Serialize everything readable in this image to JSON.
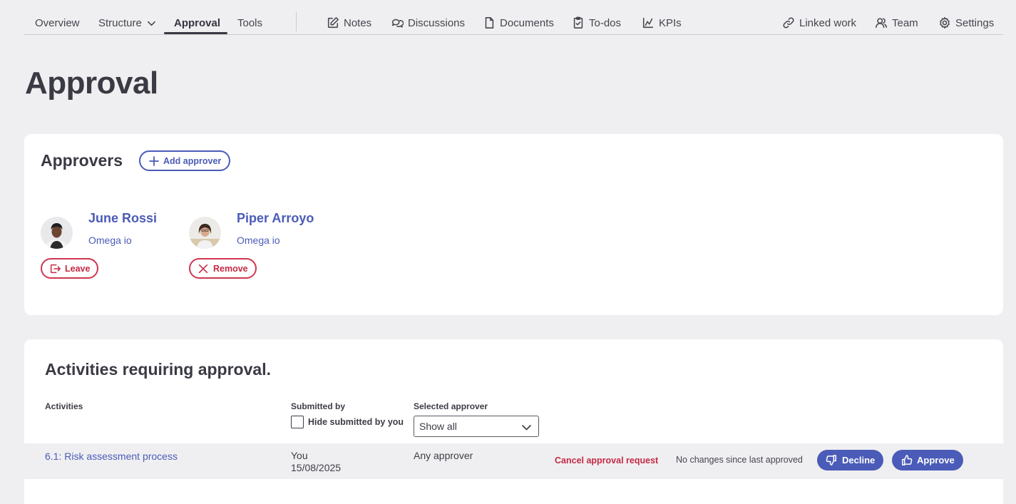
{
  "nav": {
    "left_tabs": [
      "Overview",
      "Structure",
      "Approval",
      "Tools"
    ],
    "tools": [
      "Notes",
      "Discussions",
      "Documents",
      "To-dos",
      "KPIs"
    ],
    "right": [
      "Linked work",
      "Team",
      "Settings"
    ]
  },
  "page": {
    "title": "Approval"
  },
  "approvers": {
    "title": "Approvers",
    "add_label": "Add approver",
    "items": [
      {
        "name": "June Rossi",
        "org": "Omega io",
        "action": "Leave",
        "action_icon": "leave-icon"
      },
      {
        "name": "Piper Arroyo",
        "org": "Omega io",
        "action": "Remove",
        "action_icon": "close-icon"
      }
    ]
  },
  "activities": {
    "title": "Activities requiring approval.",
    "columns": {
      "activities": "Activities",
      "submitted_by": "Submitted by",
      "selected_approver": "Selected approver"
    },
    "hide_label": "Hide submitted by you",
    "select_value": "Show all",
    "rows": [
      {
        "activity": "6.1: Risk assessment process",
        "submitter": "You",
        "date": "15/08/2025",
        "approver": "Any approver",
        "cancel": "Cancel approval request",
        "status": "No changes since last approved",
        "decline": "Decline",
        "approve": "Approve"
      }
    ]
  },
  "colors": {
    "accent": "#4b5bb8",
    "danger": "#c42a45",
    "background": "#efeff1"
  }
}
